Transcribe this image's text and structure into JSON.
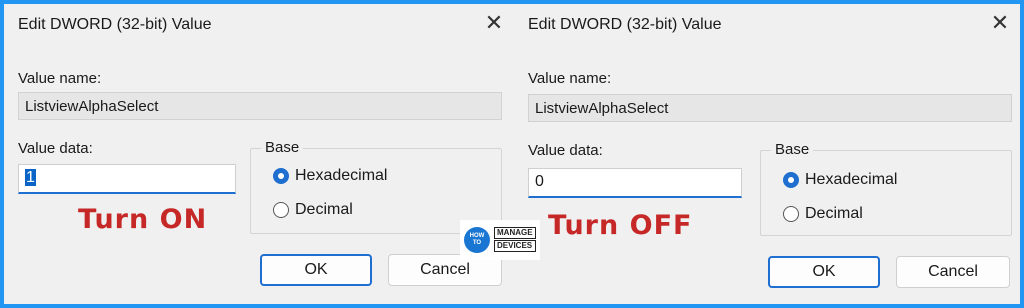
{
  "left_dialog": {
    "title": "Edit DWORD (32-bit) Value",
    "close_glyph": "✕",
    "value_name_label": "Value name:",
    "value_name": "ListviewAlphaSelect",
    "value_data_label": "Value data:",
    "value_data": "1",
    "value_data_selected": true,
    "base_label": "Base",
    "hex_label": "Hexadecimal",
    "decimal_label": "Decimal",
    "selected_base": "hexadecimal",
    "ok_label": "OK",
    "cancel_label": "Cancel"
  },
  "right_dialog": {
    "title": "Edit DWORD (32-bit) Value",
    "close_glyph": "✕",
    "value_name_label": "Value name:",
    "value_name": "ListviewAlphaSelect",
    "value_data_label": "Value data:",
    "value_data": "0",
    "value_data_selected": false,
    "base_label": "Base",
    "hex_label": "Hexadecimal",
    "decimal_label": "Decimal",
    "selected_base": "hexadecimal",
    "ok_label": "OK",
    "cancel_label": "Cancel"
  },
  "annotations": {
    "turn_on": "Turn ON",
    "turn_off": "Turn OFF"
  },
  "logo": {
    "badge_line1": "HOW",
    "badge_line2": "TO",
    "word1": "MANAGE",
    "word2": "DEVICES"
  },
  "colors": {
    "frame_border": "#2196f3",
    "accent": "#1e6fd0",
    "annotation": "#c62828"
  }
}
